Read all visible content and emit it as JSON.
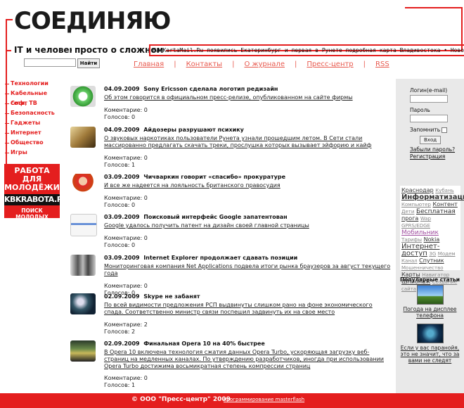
{
  "header": {
    "logo": "СОЕДИНЯЮ",
    "slogan_left": "IT и человек",
    "slogan_right": "просто о сложном",
    "ticker": "На KartaMail.Ru появились Екатеринбург и первая в Рунете подробная карта Владивостока  • Новости IT • Мн",
    "search_button": "Найти",
    "search_value": ""
  },
  "topnav": [
    "Главная",
    "Контакты",
    "О журнале",
    "Пресс-центр",
    "RSS"
  ],
  "topnav_sep": "|",
  "leftmenu": [
    "Технологии",
    "Кабельные сети, ТВ",
    "Софт",
    "Безопасность",
    "Гаджеты",
    "Интернет",
    "Общество",
    "Игры"
  ],
  "promo": {
    "line1": "РАБОТА ДЛЯ МОЛОДЁЖИ",
    "line2": "KBKRABOTA.RU",
    "line3": "ПОИСК МОЛОДЫХ СПЕЦИАЛИСТОВ"
  },
  "news": [
    {
      "date": "04.09.2009",
      "title": "Sony Ericsson сделала логотип редизайн",
      "desc": "Об этом говорится в официальном пресс-релизе, опубликованном на сайте фирмы",
      "comments": "Коментарие: 0",
      "votes": "Голосов: 0",
      "icon": "sony-ericsson-logo-icon"
    },
    {
      "date": "04.09.2009",
      "title": "Айдозеры разрушают психику",
      "desc": "О звуковых наркотиках пользователи Рунета узнали прошедшим летом. В Сети стали массированно предлагать скачать треки, прослушка которых вызывает эйфорию и кайф",
      "comments": "Коментарие: 0",
      "votes": "Голосов: 1",
      "icon": "people-image-icon"
    },
    {
      "date": "03.09.2009",
      "title": "Чичваркин говорит «спасибо» прокуратуре",
      "desc": "И все же надеется на лояльность британского правосудия",
      "comments": "Коментарие: 0",
      "votes": "Голосов: 0",
      "icon": "woman-phone-image-icon"
    },
    {
      "date": "03.09.2009",
      "title": "Поисковый интерфейс Google запатентован",
      "desc": "Google удалось получить патент на дизайн своей главной страницы",
      "comments": "Коментарие: 0",
      "votes": "Голосов: 0",
      "icon": "google-page-icon"
    },
    {
      "date": "03.09.2009",
      "title": "Internet Explorer продолжает сдавать позиции",
      "desc": "Мониторинговая компания Net Applications подвела итоги рынка браузеров за август текущего года",
      "comments": "Коментарие: 0",
      "votes": "Голосов: 0",
      "icon": "crowd-image-icon"
    },
    {
      "date": "02.09.2009",
      "title": "Skype не забанят",
      "desc": "По всей видимости предложения РСП выдвинуты слишком рано на фоне экономического спада. Соответственно министр связи поспешил задвинуть их на свое место",
      "comments": "Коментарие: 2",
      "votes": "Голосов: 2",
      "icon": "phone-keypad-icon"
    },
    {
      "date": "02.09.2009",
      "title": "Финальная Opera 10 на 40% быстрее",
      "desc": "В Opera 10 включена технология сжатия данных Opera Turbo, ускоряющая загрузку веб-страниц на медленных каналах. По утверждению разработчиков, иногда при использовании Opera Turbo достижима восьмикратная степень компрессии страниц",
      "comments": "Коментарие: 0",
      "votes": "Голосов: 1",
      "icon": "opera-screenshot-icon"
    }
  ],
  "login": {
    "login_label": "Логин(e-mail)",
    "password_label": "Пароль",
    "remember_label": "Запомнить",
    "submit": "Вход",
    "forgot": "Забыли пароль?",
    "register": "Регистрация"
  },
  "tags": [
    "Краснодар",
    "Кубань",
    "Информатизация",
    "Компьютер",
    "Контент",
    "Дети",
    "Бесплатная",
    "прога",
    "Wap",
    "GPRS/EDGE",
    "Мобильник",
    "Тарифы",
    "Nokia",
    "Интернет-доступ",
    "3G",
    "Модем",
    "Канал",
    "Спутник",
    "Мошенничество",
    "Карты",
    "Навигатор",
    "Шпионаж",
    "Создание сайта"
  ],
  "popular": {
    "title": "Популярные статьи",
    "items": [
      {
        "caption": "Погода на дисплее телефона"
      },
      {
        "caption": "Если у вас паранойя, это не значит, что за вами не следят"
      }
    ]
  },
  "footer": {
    "copyright": "© ООО \"Пресс-центр\" 2009",
    "programming": "программирование masterflash"
  },
  "colors": {
    "accent": "#e41e1e",
    "link": "#e85a4f",
    "sidebar": "#e9e9e9"
  }
}
